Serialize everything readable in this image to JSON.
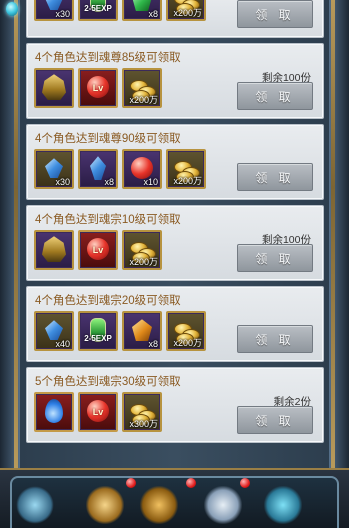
{
  "claim_label": "领 取",
  "cards": [
    {
      "title": "",
      "remaining": "",
      "items": [
        {
          "icon": "crystal-icon",
          "qty": "x30"
        },
        {
          "icon": "exp-potion-icon",
          "qty": "2-5EXP"
        },
        {
          "icon": "emerald-icon",
          "qty": "x8"
        },
        {
          "icon": "gold-coins-icon",
          "qty": "x200万"
        }
      ]
    },
    {
      "title": "4个角色达到魂尊85级可领取",
      "remaining": "剩余100份",
      "items": [
        {
          "icon": "helmet-icon",
          "qty": ""
        },
        {
          "icon": "lv-up-orb-icon",
          "qty": ""
        },
        {
          "icon": "gold-coins-icon",
          "qty": "x200万"
        }
      ]
    },
    {
      "title": "4个角色达到魂尊90级可领取",
      "remaining": "",
      "items": [
        {
          "icon": "crystal-icon",
          "qty": "x30"
        },
        {
          "icon": "blue-crystal-icon",
          "qty": "x8"
        },
        {
          "icon": "red-orb-icon",
          "qty": "x10"
        },
        {
          "icon": "gold-coins-icon",
          "qty": "x200万"
        }
      ]
    },
    {
      "title": "4个角色达到魂宗10级可领取",
      "remaining": "剩余100份",
      "items": [
        {
          "icon": "helmet-icon",
          "qty": ""
        },
        {
          "icon": "lv-up-orb-icon",
          "qty": ""
        },
        {
          "icon": "gold-coins-icon",
          "qty": "x200万"
        }
      ]
    },
    {
      "title": "4个角色达到魂宗20级可领取",
      "remaining": "",
      "items": [
        {
          "icon": "crystal-icon",
          "qty": "x40"
        },
        {
          "icon": "exp-potion-icon",
          "qty": "2-5EXP"
        },
        {
          "icon": "amber-icon",
          "qty": "x8"
        },
        {
          "icon": "gold-coins-icon",
          "qty": "x200万"
        }
      ]
    },
    {
      "title": "5个角色达到魂宗30级可领取",
      "remaining": "剩余2份",
      "items": [
        {
          "icon": "blue-drop-icon",
          "qty": ""
        },
        {
          "icon": "lv-up-orb-icon",
          "qty": ""
        },
        {
          "icon": "gold-coins-icon",
          "qty": "x300万"
        }
      ]
    }
  ],
  "lv_text": "Lv"
}
